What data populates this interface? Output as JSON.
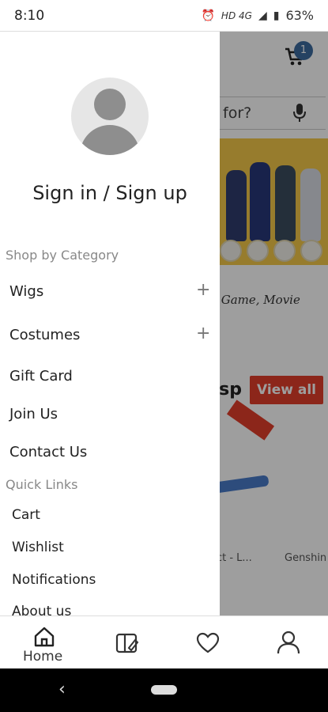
{
  "status_bar": {
    "time": "8:10",
    "net_label": "HD 4G",
    "battery": "63%"
  },
  "background_app": {
    "cart_badge": "1",
    "search_placeholder": "for?",
    "banner_caption": "V, Game, Movie",
    "section_title": "osp",
    "view_all": "View all",
    "product1_name": "act - L...",
    "product2_name": "Genshin"
  },
  "drawer": {
    "sign_in": "Sign in / Sign up",
    "shop_header": "Shop by Category",
    "categories": [
      {
        "label": "Wigs",
        "expandable": true
      },
      {
        "label": "Costumes",
        "expandable": true
      },
      {
        "label": "Gift Card"
      },
      {
        "label": "Join Us"
      },
      {
        "label": "Contact Us"
      }
    ],
    "quick_header": "Quick Links",
    "quick_links": [
      "Cart",
      "Wishlist",
      "Notifications",
      "About us"
    ]
  },
  "bottom_nav": {
    "home_label": "Home",
    "icons": [
      "home-icon",
      "catalog-icon",
      "heart-icon",
      "user-icon"
    ]
  },
  "colors": {
    "accent_red": "#e23e2b",
    "badge_blue": "#3d6b9e",
    "banner_yellow": "#f4c94a"
  }
}
